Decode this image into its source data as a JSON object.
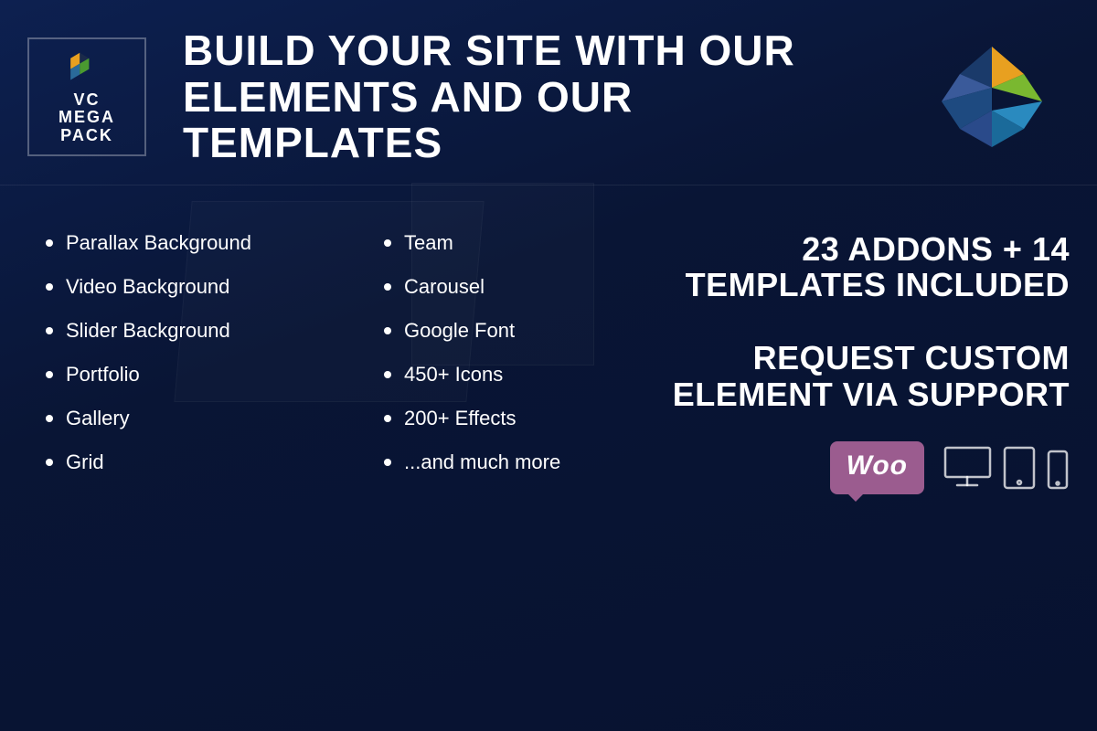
{
  "header": {
    "logo_text_line1": "VC",
    "logo_text_line2": "MEGA",
    "logo_text_line3": "PACK",
    "title_line1": "BUILD YOUR SITE WITH OUR",
    "title_line2": "ELEMENTS AND OUR TEMPLATES"
  },
  "features_left": {
    "items": [
      {
        "label": "Parallax Background"
      },
      {
        "label": "Video Background"
      },
      {
        "label": "Slider Background"
      },
      {
        "label": "Portfolio"
      },
      {
        "label": "Gallery"
      },
      {
        "label": "Grid"
      }
    ]
  },
  "features_middle": {
    "items": [
      {
        "label": "Team"
      },
      {
        "label": "Carousel"
      },
      {
        "label": "Google Font"
      },
      {
        "label": "450+ Icons"
      },
      {
        "label": "200+ Effects"
      },
      {
        "label": "...and much more"
      }
    ]
  },
  "stats": {
    "primary": "23 ADDONS + 14\nTEMPLATES INCLUDED",
    "secondary": "REQUEST CUSTOM\nELEMENT VIA SUPPORT"
  },
  "woo": {
    "label": "Woo"
  },
  "devices": {
    "monitor_label": "desktop-icon",
    "tablet_label": "tablet-icon",
    "phone_label": "phone-icon"
  }
}
